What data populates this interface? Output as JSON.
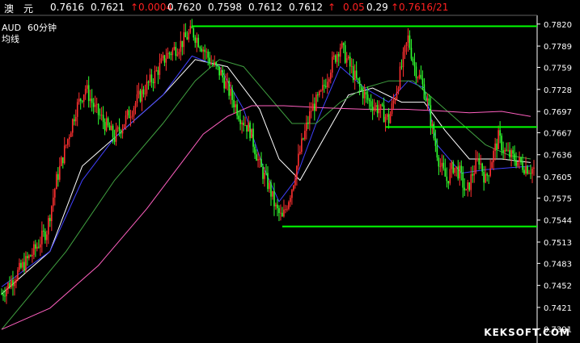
{
  "quote_bar": {
    "name": "澳　元",
    "open": "0.7616",
    "close": "0.7621",
    "change": "↑0.0004",
    "high": "0.7620",
    "low": "0.7598",
    "v6": "0.7612",
    "v7": "0.7612",
    "arrow": "↑",
    "pct": "0.05",
    "amp": "0.29",
    "last": "↑0.7616/21"
  },
  "colors": {
    "background": "#000000",
    "up_candle": "#ff3030",
    "down_candle": "#30ff30",
    "ma_white": "#ffffff",
    "ma_blue": "#4040ff",
    "ma_green": "#40a040",
    "ma_pink": "#ff60c0",
    "trendline": "#00ff00",
    "axis": "#ffffff",
    "quote_red": "#ff2020"
  },
  "chart_data": {
    "type": "candlestick",
    "symbol": "AUD",
    "period": "60分钟",
    "indicator": "均线",
    "y_ticks": [
      "0.7820",
      "0.7789",
      "0.7759",
      "0.7728",
      "0.7697",
      "0.7667",
      "0.7636",
      "0.7605",
      "0.7575",
      "0.7544",
      "0.7513",
      "0.7483",
      "0.7452",
      "0.7421",
      "0.7391"
    ],
    "ylim": [
      0.738,
      0.783
    ],
    "xlim": [
      0,
      330
    ],
    "horizontal_lines": [
      {
        "y": 0.7817,
        "x_start": 118,
        "x_end": 330
      },
      {
        "y": 0.7675,
        "x_start": 238,
        "x_end": 330
      },
      {
        "y": 0.7535,
        "x_start": 174,
        "x_end": 330
      }
    ],
    "price_path": [
      [
        0,
        0.744
      ],
      [
        10,
        0.747
      ],
      [
        20,
        0.75
      ],
      [
        28,
        0.753
      ],
      [
        34,
        0.76
      ],
      [
        40,
        0.765
      ],
      [
        46,
        0.77
      ],
      [
        52,
        0.773
      ],
      [
        58,
        0.77
      ],
      [
        64,
        0.768
      ],
      [
        70,
        0.766
      ],
      [
        78,
        0.769
      ],
      [
        86,
        0.772
      ],
      [
        94,
        0.7745
      ],
      [
        102,
        0.7775
      ],
      [
        110,
        0.779
      ],
      [
        118,
        0.781
      ],
      [
        124,
        0.779
      ],
      [
        130,
        0.7765
      ],
      [
        136,
        0.775
      ],
      [
        142,
        0.772
      ],
      [
        148,
        0.769
      ],
      [
        154,
        0.767
      ],
      [
        160,
        0.762
      ],
      [
        166,
        0.759
      ],
      [
        170,
        0.756
      ],
      [
        174,
        0.7545
      ],
      [
        180,
        0.759
      ],
      [
        186,
        0.765
      ],
      [
        192,
        0.77
      ],
      [
        198,
        0.772
      ],
      [
        204,
        0.776
      ],
      [
        210,
        0.779
      ],
      [
        216,
        0.776
      ],
      [
        222,
        0.773
      ],
      [
        228,
        0.771
      ],
      [
        234,
        0.77
      ],
      [
        240,
        0.7685
      ],
      [
        244,
        0.772
      ],
      [
        248,
        0.776
      ],
      [
        252,
        0.78
      ],
      [
        256,
        0.776
      ],
      [
        260,
        0.774
      ],
      [
        264,
        0.771
      ],
      [
        268,
        0.766
      ],
      [
        272,
        0.762
      ],
      [
        276,
        0.76
      ],
      [
        280,
        0.762
      ],
      [
        284,
        0.761
      ],
      [
        288,
        0.758
      ],
      [
        292,
        0.761
      ],
      [
        296,
        0.763
      ],
      [
        300,
        0.76
      ],
      [
        304,
        0.763
      ],
      [
        308,
        0.766
      ],
      [
        312,
        0.764
      ],
      [
        318,
        0.763
      ],
      [
        324,
        0.762
      ],
      [
        328,
        0.7616
      ]
    ],
    "moving_averages": [
      {
        "key": "white",
        "path": [
          [
            0,
            0.744
          ],
          [
            30,
            0.75
          ],
          [
            50,
            0.762
          ],
          [
            70,
            0.766
          ],
          [
            100,
            0.772
          ],
          [
            120,
            0.777
          ],
          [
            140,
            0.776
          ],
          [
            160,
            0.77
          ],
          [
            172,
            0.763
          ],
          [
            185,
            0.76
          ],
          [
            200,
            0.766
          ],
          [
            215,
            0.772
          ],
          [
            230,
            0.773
          ],
          [
            248,
            0.771
          ],
          [
            262,
            0.771
          ],
          [
            275,
            0.767
          ],
          [
            290,
            0.763
          ],
          [
            310,
            0.763
          ],
          [
            328,
            0.7625
          ]
        ]
      },
      {
        "key": "blue",
        "path": [
          [
            0,
            0.745
          ],
          [
            30,
            0.75
          ],
          [
            50,
            0.76
          ],
          [
            70,
            0.766
          ],
          [
            100,
            0.772
          ],
          [
            118,
            0.7775
          ],
          [
            135,
            0.776
          ],
          [
            150,
            0.77
          ],
          [
            162,
            0.762
          ],
          [
            172,
            0.757
          ],
          [
            182,
            0.76
          ],
          [
            195,
            0.768
          ],
          [
            210,
            0.776
          ],
          [
            225,
            0.773
          ],
          [
            240,
            0.771
          ],
          [
            252,
            0.774
          ],
          [
            262,
            0.773
          ],
          [
            270,
            0.765
          ],
          [
            285,
            0.761
          ],
          [
            300,
            0.7615
          ],
          [
            328,
            0.762
          ]
        ]
      },
      {
        "key": "green",
        "path": [
          [
            0,
            0.739
          ],
          [
            40,
            0.75
          ],
          [
            70,
            0.76
          ],
          [
            100,
            0.768
          ],
          [
            120,
            0.774
          ],
          [
            135,
            0.777
          ],
          [
            150,
            0.776
          ],
          [
            165,
            0.772
          ],
          [
            180,
            0.768
          ],
          [
            195,
            0.768
          ],
          [
            210,
            0.771
          ],
          [
            225,
            0.773
          ],
          [
            240,
            0.774
          ],
          [
            255,
            0.774
          ],
          [
            270,
            0.771
          ],
          [
            285,
            0.768
          ],
          [
            300,
            0.765
          ],
          [
            315,
            0.7635
          ],
          [
            328,
            0.763
          ]
        ]
      },
      {
        "key": "pink",
        "path": [
          [
            0,
            0.739
          ],
          [
            30,
            0.742
          ],
          [
            60,
            0.748
          ],
          [
            90,
            0.756
          ],
          [
            110,
            0.762
          ],
          [
            125,
            0.7665
          ],
          [
            140,
            0.769
          ],
          [
            155,
            0.7705
          ],
          [
            175,
            0.7705
          ],
          [
            200,
            0.7702
          ],
          [
            225,
            0.77
          ],
          [
            250,
            0.77
          ],
          [
            270,
            0.7698
          ],
          [
            290,
            0.7695
          ],
          [
            310,
            0.7697
          ],
          [
            328,
            0.769
          ]
        ]
      }
    ]
  },
  "watermark": "KEKSOFT.COM"
}
